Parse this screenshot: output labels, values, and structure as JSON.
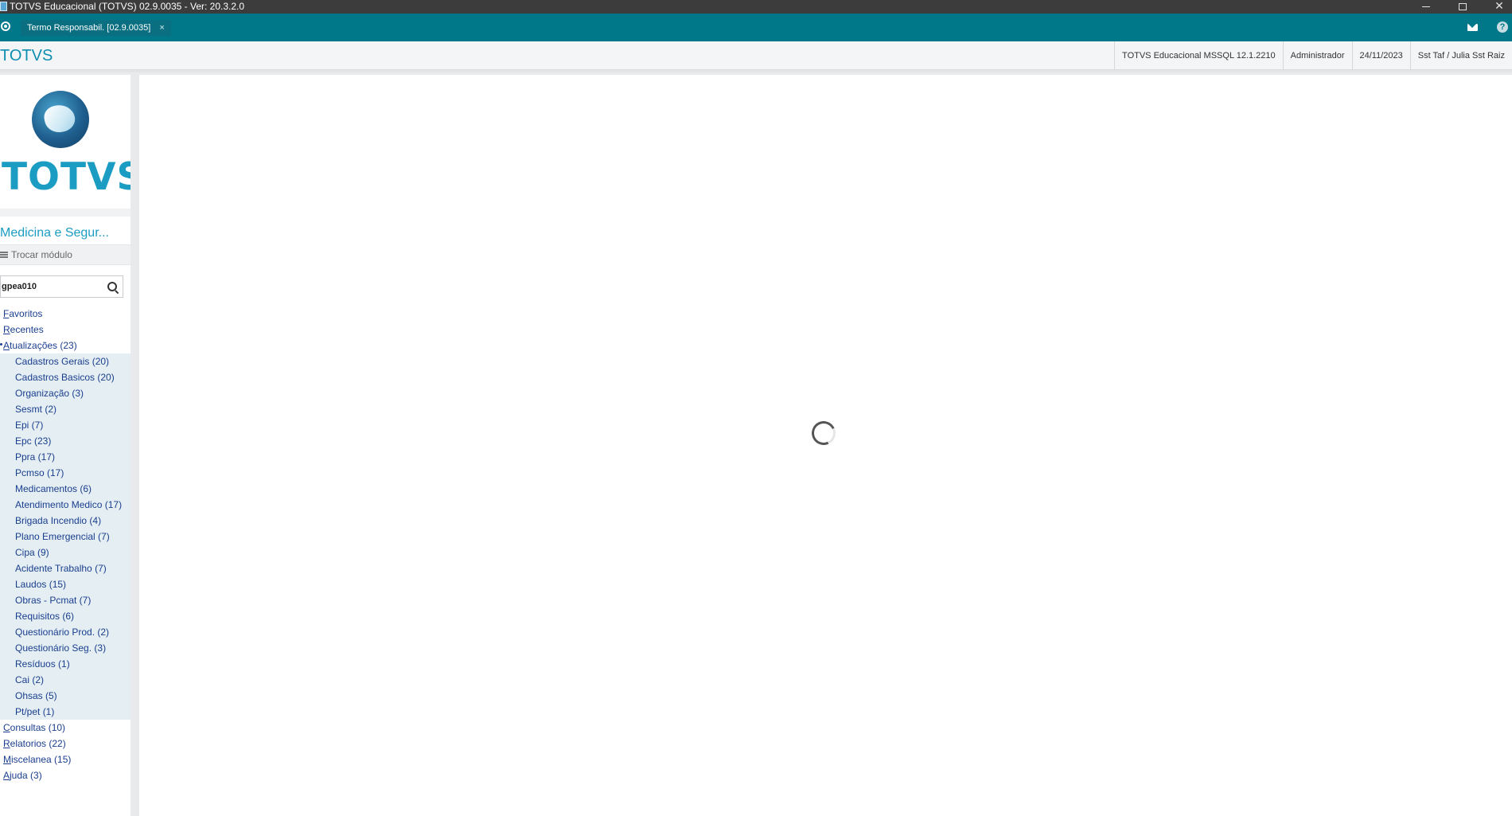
{
  "os_window": {
    "title": "TOTVS Educacional (TOTVS) 02.9.0035 - Ver: 20.3.2.0"
  },
  "tabbar": {
    "active_tab_label": "Termo Responsabil. [02.9.0035]",
    "close_glyph": "×",
    "icons": [
      "home-icon",
      "mail-icon",
      "help-icon"
    ]
  },
  "header": {
    "brand": "TOTVS",
    "environment": "TOTVS Educacional MSSQL 12.1.2210",
    "user": "Administrador",
    "date": "24/11/2023",
    "branch": "Sst Taf / Julia Sst Raiz"
  },
  "sidebar": {
    "logo_text": "TOTVS",
    "module_title": "Medicina e Segur...",
    "switch_module_label": "Trocar módulo",
    "search": {
      "value": "gpea010",
      "placeholder": ""
    },
    "menu_top": [
      {
        "accel": "F",
        "rest": "avoritos"
      },
      {
        "accel": "R",
        "rest": "ecentes"
      },
      {
        "accel": "A",
        "rest": "tualizações (23)"
      }
    ],
    "submenu": [
      "Cadastros Gerais (20)",
      "Cadastros Basicos (20)",
      "Organização (3)",
      "Sesmt (2)",
      "Epi (7)",
      "Epc (23)",
      "Ppra (17)",
      "Pcmso (17)",
      "Medicamentos (6)",
      "Atendimento Medico (17)",
      "Brigada Incendio (4)",
      "Plano Emergencial (7)",
      "Cipa (9)",
      "Acidente Trabalho (7)",
      "Laudos (15)",
      "Obras - Pcmat (7)",
      "Requisitos (6)",
      "Questionário Prod. (2)",
      "Questionário Seg. (3)",
      "Resíduos (1)",
      "Cai (2)",
      "Ohsas (5)",
      "Pt/pet (1)"
    ],
    "menu_bottom": [
      {
        "accel": "C",
        "rest": "onsultas (10)"
      },
      {
        "accel": "R",
        "rest": "elatorios (22)"
      },
      {
        "accel": "M",
        "rest": "iscelanea (15)"
      },
      {
        "accel": "A",
        "rest": "juda (3)"
      }
    ]
  },
  "main": {
    "state": "loading"
  },
  "colors": {
    "tabbar": "#00788a",
    "brand": "#1b9cc2",
    "menu_link": "#1a3e8f",
    "submenu_bg": "#e4eef3"
  }
}
